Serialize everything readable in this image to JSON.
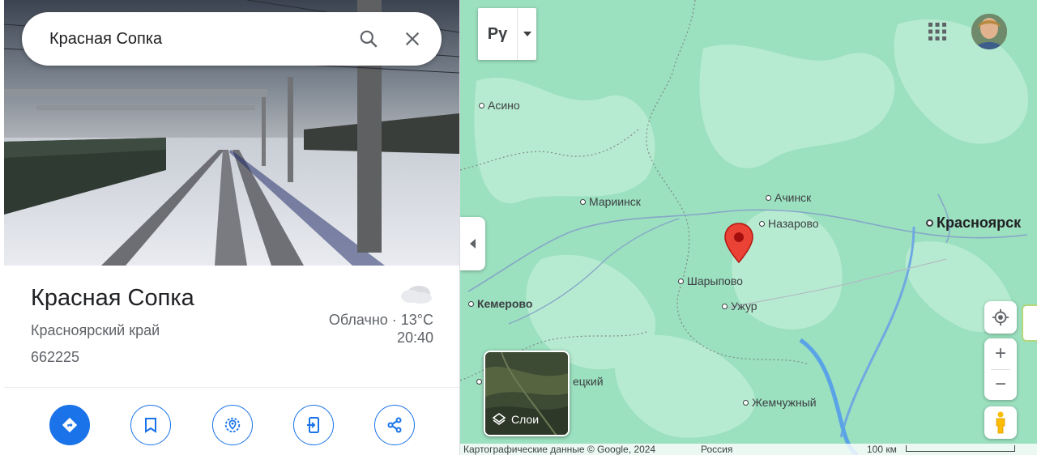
{
  "search": {
    "query": "Красная Сопка"
  },
  "place": {
    "name": "Красная Сопка",
    "region": "Красноярский край",
    "postal_code": "662225",
    "weather": "Облачно · 13°C",
    "time": "20:40"
  },
  "map": {
    "language_button": "Pγ",
    "layers_label": "Слои",
    "attribution": "Картографические данные © Google, 2024",
    "country": "Россия",
    "scale_label": "100 км",
    "zoom_in": "+",
    "zoom_out": "−",
    "cities": {
      "asino": "Асино",
      "mariinsk": "Мариинск",
      "achinsk": "Ачинск",
      "nazarovo": "Назарово",
      "krasnoyarsk": "Красноярск",
      "sharypovo": "Шарыпово",
      "kemerovo": "Кемерово",
      "uzhur": "Ужур",
      "etsky": "ецкий",
      "zhemchuzhny": "Жемчужный"
    }
  },
  "colors": {
    "accent": "#1a73e8",
    "map_green": "#9be0bf",
    "pin_red": "#ea4335"
  }
}
